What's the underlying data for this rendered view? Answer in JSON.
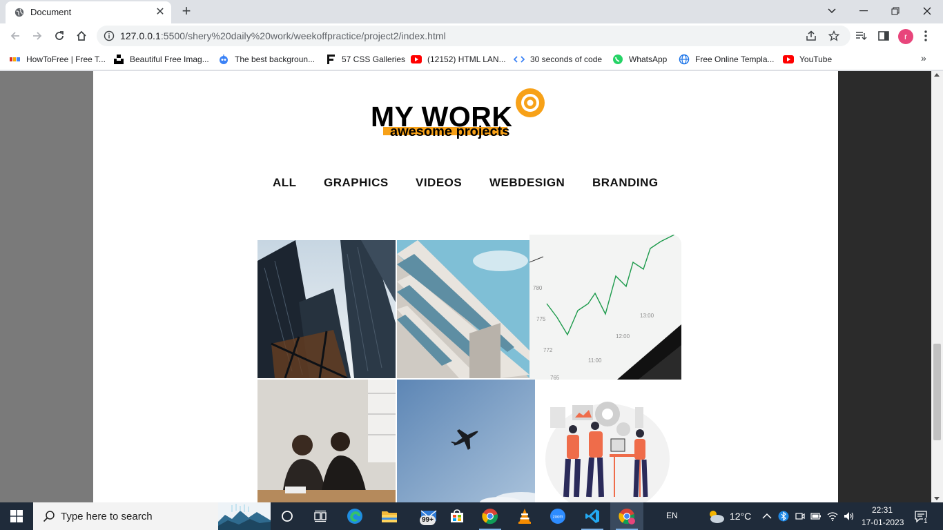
{
  "browser": {
    "tab_title": "Document",
    "url_host": "127.0.0.1",
    "url_rest": ":5500/shery%20daily%20work/weekoffpractice/project2/index.html",
    "profile_initial": "r",
    "bookmarks": [
      {
        "label": "HowToFree | Free T...",
        "icon": "howtofree-icon"
      },
      {
        "label": "Beautiful Free Imag...",
        "icon": "unsplash-icon"
      },
      {
        "label": "The best backgroun...",
        "icon": "robot-icon"
      },
      {
        "label": "57 CSS Galleries",
        "icon": "f-logo-icon"
      },
      {
        "label": "(12152) HTML LAN...",
        "icon": "youtube-icon"
      },
      {
        "label": "30 seconds of code",
        "icon": "code-icon"
      },
      {
        "label": "WhatsApp",
        "icon": "whatsapp-icon"
      },
      {
        "label": "Free Online Templa...",
        "icon": "globe-icon"
      },
      {
        "label": "YouTube",
        "icon": "youtube-icon"
      }
    ]
  },
  "page": {
    "logo_title": "MY WORK",
    "logo_subtitle": "awesome projects",
    "accent_color": "#f7a118",
    "nav": [
      "ALL",
      "GRAPHICS",
      "VIDEOS",
      "WEBDESIGN",
      "BRANDING"
    ],
    "gallery": [
      {
        "name": "skyscrapers-image"
      },
      {
        "name": "building-balconies-image"
      },
      {
        "name": "stock-chart-image"
      },
      {
        "name": "two-people-working-image"
      },
      {
        "name": "airplane-sky-image"
      },
      {
        "name": "team-illustration-image"
      }
    ]
  },
  "taskbar": {
    "search_placeholder": "Type here to search",
    "language": "EN",
    "temperature": "12°C",
    "time": "22:31",
    "date": "17-01-2023",
    "mail_badge": "99+",
    "notification_count": "1"
  }
}
